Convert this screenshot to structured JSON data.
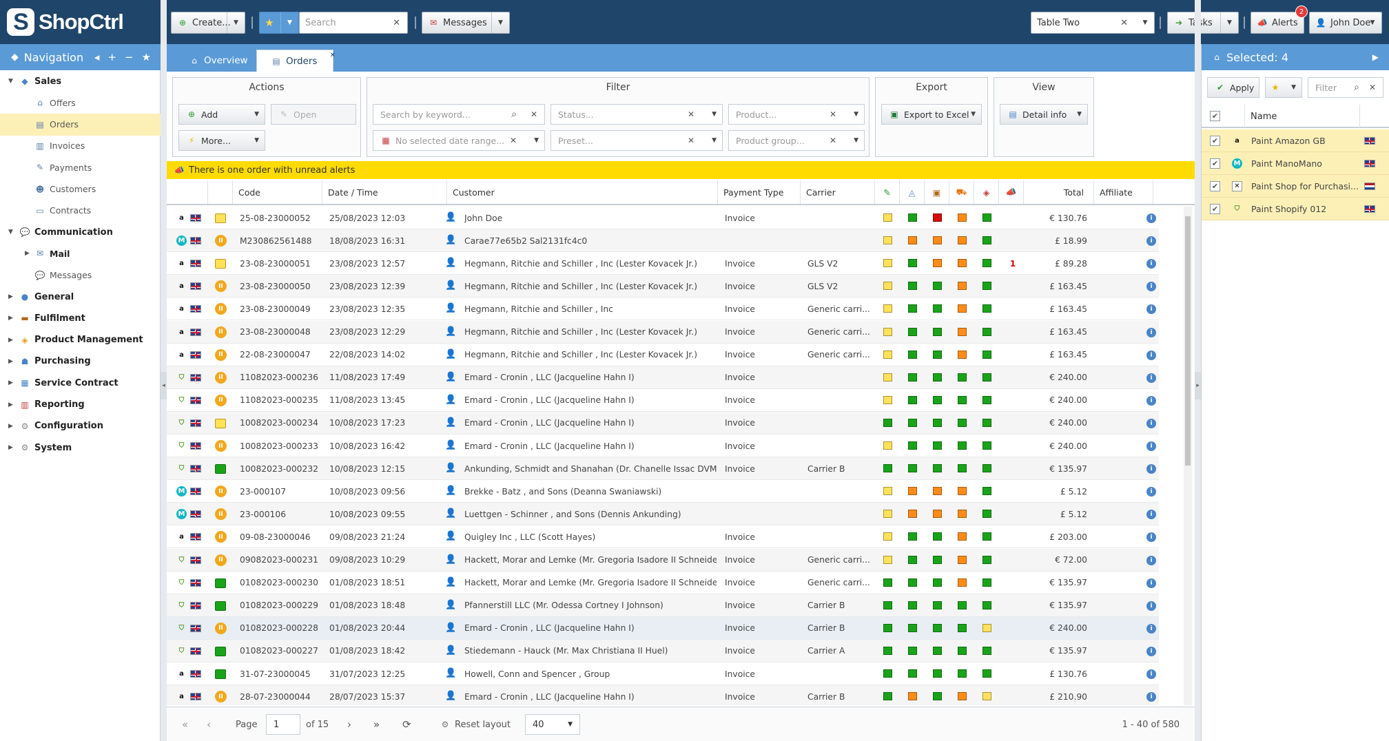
{
  "app": {
    "logo": "ShopCtrl"
  },
  "topbar": {
    "create_label": "Create...",
    "search_placeholder": "Search",
    "messages_label": "Messages",
    "table_select": "Table Two",
    "tasks_label": "Tasks",
    "alerts_label": "Alerts",
    "alerts_count": "2",
    "user_label": "John Doe"
  },
  "nav": {
    "title": "Navigation",
    "items": [
      {
        "label": "Sales",
        "level": "top",
        "icon": "sales-icon"
      },
      {
        "label": "Offers",
        "level": "sub",
        "icon": "offers-icon"
      },
      {
        "label": "Orders",
        "level": "sub",
        "icon": "orders-icon"
      },
      {
        "label": "Invoices",
        "level": "sub",
        "icon": "invoices-icon"
      },
      {
        "label": "Payments",
        "level": "sub",
        "icon": "payments-icon"
      },
      {
        "label": "Customers",
        "level": "sub",
        "icon": "customers-icon"
      },
      {
        "label": "Contracts",
        "level": "sub",
        "icon": "contracts-icon"
      },
      {
        "label": "Communication",
        "level": "top",
        "icon": "communication-icon"
      },
      {
        "label": "Mail",
        "level": "mid",
        "icon": "mail-icon"
      },
      {
        "label": "Messages",
        "level": "sub",
        "icon": "messages-icon"
      },
      {
        "label": "General",
        "level": "top",
        "icon": "general-icon"
      },
      {
        "label": "Fulfilment",
        "level": "top",
        "icon": "fulfilment-icon"
      },
      {
        "label": "Product Management",
        "level": "top",
        "icon": "product-icon"
      },
      {
        "label": "Purchasing",
        "level": "top",
        "icon": "purchasing-icon"
      },
      {
        "label": "Service Contract",
        "level": "top",
        "icon": "service-contract-icon"
      },
      {
        "label": "Reporting",
        "level": "top",
        "icon": "reporting-icon"
      },
      {
        "label": "Configuration",
        "level": "top",
        "icon": "configuration-icon"
      },
      {
        "label": "System",
        "level": "top",
        "icon": "system-icon"
      }
    ]
  },
  "tabs": {
    "overview": "Overview",
    "orders": "Orders"
  },
  "toolbar": {
    "actions_title": "Actions",
    "add_label": "Add",
    "open_label": "Open",
    "more_label": "More...",
    "filter_title": "Filter",
    "keyword_placeholder": "Search by keyword...",
    "status_placeholder": "Status...",
    "product_placeholder": "Product...",
    "date_placeholder": "No selected date range...",
    "preset_placeholder": "Preset...",
    "product_group_placeholder": "Product group...",
    "export_title": "Export",
    "export_label": "Export to Excel",
    "view_title": "View",
    "view_label": "Detail info"
  },
  "alert_text": "There is one order with unread alerts",
  "columns": {
    "code": "Code",
    "datetime": "Date / Time",
    "customer": "Customer",
    "payment_type": "Payment Type",
    "carrier": "Carrier",
    "total": "Total",
    "affiliate": "Affiliate"
  },
  "orders": [
    {
      "channel": "amazon",
      "status": "yellow",
      "code": "25-08-23000052",
      "datetime": "25/08/2023 12:03",
      "customer": "John Doe",
      "payment": "Invoice",
      "carrier": "",
      "sq": [
        "y",
        "g",
        "r",
        "o",
        "g"
      ],
      "alerts": "",
      "total": "€ 130.76"
    },
    {
      "channel": "manomano",
      "status": "pause",
      "code": "M230862561488",
      "datetime": "18/08/2023 16:31",
      "customer": "Carae77e65b2 Sal2131fc4c0",
      "payment": "",
      "carrier": "",
      "sq": [
        "y",
        "o",
        "o",
        "o",
        "g"
      ],
      "alerts": "",
      "total": "£ 18.99"
    },
    {
      "channel": "amazon",
      "status": "yellow",
      "code": "23-08-23000051",
      "datetime": "23/08/2023 12:57",
      "customer": "Hegmann, Ritchie and Schiller , Inc (Lester Kovacek Jr.)",
      "payment": "Invoice",
      "carrier": "GLS V2",
      "sq": [
        "y",
        "g",
        "o",
        "o",
        "g"
      ],
      "alerts": "1",
      "total": "£ 89.28"
    },
    {
      "channel": "amazon",
      "status": "pause",
      "code": "23-08-23000050",
      "datetime": "23/08/2023 12:39",
      "customer": "Hegmann, Ritchie and Schiller , Inc (Lester Kovacek Jr.)",
      "payment": "Invoice",
      "carrier": "GLS V2",
      "sq": [
        "y",
        "g",
        "g",
        "o",
        "g"
      ],
      "alerts": "",
      "total": "£ 163.45"
    },
    {
      "channel": "amazon",
      "status": "pause",
      "code": "23-08-23000049",
      "datetime": "23/08/2023 12:35",
      "customer": "Hegmann, Ritchie and Schiller , Inc",
      "payment": "Invoice",
      "carrier": "Generic carri...",
      "sq": [
        "y",
        "g",
        "g",
        "o",
        "g"
      ],
      "alerts": "",
      "total": "£ 163.45"
    },
    {
      "channel": "amazon",
      "status": "pause",
      "code": "23-08-23000048",
      "datetime": "23/08/2023 12:29",
      "customer": "Hegmann, Ritchie and Schiller , Inc (Lester Kovacek Jr.)",
      "payment": "Invoice",
      "carrier": "Generic carri...",
      "sq": [
        "y",
        "g",
        "g",
        "o",
        "g"
      ],
      "alerts": "",
      "total": "£ 163.45"
    },
    {
      "channel": "amazon",
      "status": "pause",
      "code": "22-08-23000047",
      "datetime": "22/08/2023 14:02",
      "customer": "Hegmann, Ritchie and Schiller , Inc (Lester Kovacek Jr.)",
      "payment": "Invoice",
      "carrier": "Generic carri...",
      "sq": [
        "y",
        "g",
        "g",
        "o",
        "g"
      ],
      "alerts": "",
      "total": "£ 163.45"
    },
    {
      "channel": "shopify",
      "status": "pause",
      "code": "11082023-000236",
      "datetime": "11/08/2023 17:49",
      "customer": "Emard - Cronin , LLC (Jacqueline Hahn I)",
      "payment": "Invoice",
      "carrier": "",
      "sq": [
        "y",
        "g",
        "g",
        "g",
        "g"
      ],
      "alerts": "",
      "total": "€ 240.00"
    },
    {
      "channel": "shopify",
      "status": "pause",
      "code": "11082023-000235",
      "datetime": "11/08/2023 13:45",
      "customer": "Emard - Cronin , LLC (Jacqueline Hahn I)",
      "payment": "Invoice",
      "carrier": "",
      "sq": [
        "y",
        "g",
        "g",
        "g",
        "g"
      ],
      "alerts": "",
      "total": "€ 240.00"
    },
    {
      "channel": "shopify",
      "status": "yellow",
      "code": "10082023-000234",
      "datetime": "10/08/2023 17:23",
      "customer": "Emard - Cronin , LLC (Jacqueline Hahn I)",
      "payment": "Invoice",
      "carrier": "",
      "sq": [
        "g",
        "g",
        "g",
        "g",
        "g"
      ],
      "alerts": "",
      "total": "€ 240.00"
    },
    {
      "channel": "shopify",
      "status": "pause",
      "code": "10082023-000233",
      "datetime": "10/08/2023 16:42",
      "customer": "Emard - Cronin , LLC (Jacqueline Hahn I)",
      "payment": "Invoice",
      "carrier": "",
      "sq": [
        "y",
        "g",
        "g",
        "g",
        "g"
      ],
      "alerts": "",
      "total": "€ 240.00"
    },
    {
      "channel": "shopify",
      "status": "green",
      "code": "10082023-000232",
      "datetime": "10/08/2023 12:15",
      "customer": "Ankunding, Schmidt and Shanahan (Dr. Chanelle Issac DVM Car",
      "payment": "Invoice",
      "carrier": "Carrier B",
      "sq": [
        "g",
        "g",
        "g",
        "g",
        "g"
      ],
      "alerts": "",
      "total": "€ 135.97"
    },
    {
      "channel": "manomano",
      "status": "pause",
      "code": "23-000107",
      "datetime": "10/08/2023 09:56",
      "customer": "Brekke - Batz , and Sons (Deanna Swaniawski)",
      "payment": "",
      "carrier": "",
      "sq": [
        "y",
        "o",
        "o",
        "o",
        "g"
      ],
      "alerts": "",
      "total": "£ 5.12"
    },
    {
      "channel": "manomano",
      "status": "pause",
      "code": "23-000106",
      "datetime": "10/08/2023 09:55",
      "customer": "Luettgen - Schinner , and Sons (Dennis Ankunding)",
      "payment": "",
      "carrier": "",
      "sq": [
        "y",
        "o",
        "o",
        "o",
        "g"
      ],
      "alerts": "",
      "total": "£ 5.12"
    },
    {
      "channel": "amazon",
      "status": "pause",
      "code": "09-08-23000046",
      "datetime": "09/08/2023 21:24",
      "customer": "Quigley Inc , LLC (Scott Hayes)",
      "payment": "Invoice",
      "carrier": "",
      "sq": [
        "y",
        "g",
        "g",
        "o",
        "g"
      ],
      "alerts": "",
      "total": "£ 203.00"
    },
    {
      "channel": "shopify",
      "status": "pause",
      "code": "09082023-000231",
      "datetime": "09/08/2023 10:29",
      "customer": "Hackett, Morar and Lemke (Mr. Gregoria Isadore II Schneider)",
      "payment": "Invoice",
      "carrier": "Generic carri...",
      "sq": [
        "y",
        "g",
        "g",
        "o",
        "g"
      ],
      "alerts": "",
      "total": "€ 72.00"
    },
    {
      "channel": "shopify",
      "status": "green",
      "code": "01082023-000230",
      "datetime": "01/08/2023 18:51",
      "customer": "Hackett, Morar and Lemke (Mr. Gregoria Isadore II Schneider)",
      "payment": "Invoice",
      "carrier": "Generic carri...",
      "sq": [
        "g",
        "g",
        "g",
        "o",
        "g"
      ],
      "alerts": "",
      "total": "€ 135.97"
    },
    {
      "channel": "shopify",
      "status": "green",
      "code": "01082023-000229",
      "datetime": "01/08/2023 18:48",
      "customer": "Pfannerstill LLC (Mr. Odessa Cortney I Johnson)",
      "payment": "Invoice",
      "carrier": "Carrier B",
      "sq": [
        "g",
        "g",
        "g",
        "g",
        "g"
      ],
      "alerts": "",
      "total": "€ 135.97"
    },
    {
      "channel": "shopify",
      "status": "pause",
      "code": "01082023-000228",
      "datetime": "01/08/2023 20:44",
      "customer": "Emard - Cronin , LLC (Jacqueline Hahn I)",
      "payment": "Invoice",
      "carrier": "Carrier B",
      "sq": [
        "g",
        "g",
        "g",
        "g",
        "y"
      ],
      "alerts": "",
      "total": "€ 240.00"
    },
    {
      "channel": "shopify",
      "status": "green",
      "code": "01082023-000227",
      "datetime": "01/08/2023 18:42",
      "customer": "Stiedemann - Hauck (Mr. Max Christiana II Huel)",
      "payment": "Invoice",
      "carrier": "Carrier A",
      "sq": [
        "g",
        "g",
        "g",
        "g",
        "g"
      ],
      "alerts": "",
      "total": "€ 135.97"
    },
    {
      "channel": "amazon",
      "status": "green",
      "code": "31-07-23000045",
      "datetime": "31/07/2023 12:25",
      "customer": "Howell, Conn and Spencer , Group",
      "payment": "Invoice",
      "carrier": "",
      "sq": [
        "g",
        "g",
        "g",
        "g",
        "g"
      ],
      "alerts": "",
      "total": "£ 130.76"
    },
    {
      "channel": "amazon",
      "status": "pause",
      "code": "28-07-23000044",
      "datetime": "28/07/2023 15:37",
      "customer": "Emard - Cronin , LLC (Jacqueline Hahn I)",
      "payment": "Invoice",
      "carrier": "Carrier B",
      "sq": [
        "g",
        "o",
        "g",
        "o",
        "y"
      ],
      "alerts": "",
      "total": "£ 210.90"
    }
  ],
  "pager": {
    "page_label": "Page",
    "page_value": "1",
    "of_label": "of 15",
    "reset_label": "Reset layout",
    "page_size": "40",
    "summary": "1 - 40 of 580"
  },
  "right_panel": {
    "title": "Selected: 4",
    "apply_label": "Apply",
    "filter_placeholder": "Filter",
    "name_header": "Name",
    "rows": [
      {
        "channel": "amazon",
        "name": "Paint Amazon GB",
        "flag": "gb"
      },
      {
        "channel": "manomano",
        "name": "Paint ManoMano",
        "flag": "gb"
      },
      {
        "channel": "x",
        "name": "Paint Shop for Purchasi...",
        "flag": "nl"
      },
      {
        "channel": "shopify",
        "name": "Paint Shopify 012",
        "flag": "gb"
      }
    ]
  },
  "colors": {
    "topbar": "#1f456a",
    "accent": "#5a9ad6",
    "selection": "#fdf0b7",
    "alert": "#ffdb00"
  }
}
